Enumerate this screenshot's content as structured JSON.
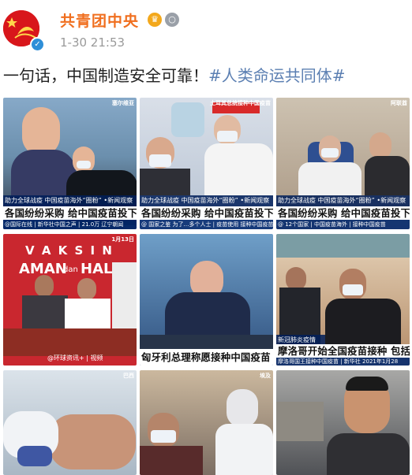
{
  "account": {
    "name": "共青团中央",
    "time": "1-30 21:53",
    "verified": "✓",
    "badge_a": "♛",
    "badge_b": "○"
  },
  "post": {
    "text": "一句话，中国制造安全可靠！",
    "hashtag": "#人类命运共同体#"
  },
  "tiles": [
    {
      "corner": "塞尔维亚",
      "bar": "助力全球战疫  中国疫苗海外“圈粉”  •新闻观察",
      "caption": "各国纷纷采购 给中国疫苗投下",
      "foot": "@国际在线 | 新华社中国之声 | 21.0万 辽宁朝闻"
    },
    {
      "corner": "土耳其总统接种中国疫苗",
      "bar": "助力全球战疫  中国疫苗海外“圈粉”  •新闻观察",
      "caption": "各国纷纷采购 给中国疫苗投下",
      "foot": "@ 国家之鉴 为了…多个人士 | 疫苗使用 接种中国疫苗"
    },
    {
      "corner": "阿联酋",
      "bar": "助力全球战疫  中国疫苗海外“圈粉”  •新闻观察",
      "caption": "各国纷纷采购 给中国疫苗投下",
      "foot": "@ 12个国家 | 中国疫苗海外 | 接种中国疫苗"
    },
    {
      "corner": "1月13日",
      "bar": "",
      "caption": "",
      "foot": "@环球资讯+  | 视频"
    },
    {
      "corner": "",
      "bar": "",
      "caption": "匈牙利总理称愿接种中国疫苗",
      "foot": ""
    },
    {
      "corner": "",
      "bar": "新冠肺炎疫情",
      "caption": "摩洛哥开始全国疫苗接种 包括中",
      "foot": "摩洛哥国王接种中国疫苗 | 新华社 2021年1月28"
    },
    {
      "corner": "巴西",
      "bar": "",
      "caption": "",
      "foot": ""
    },
    {
      "corner": "埃及",
      "bar": "",
      "caption": "",
      "foot": ""
    },
    {
      "corner": "",
      "bar": "",
      "caption": "",
      "foot": ""
    }
  ],
  "indonesia_banner": {
    "line1": "V A K S I N",
    "line2": "AMAN",
    "line3": "dan",
    "line4": "HALAL"
  },
  "colors": {
    "name": "#f06f1f",
    "hashtag": "#5b7fb2",
    "caption_bar": "#001e5a"
  }
}
